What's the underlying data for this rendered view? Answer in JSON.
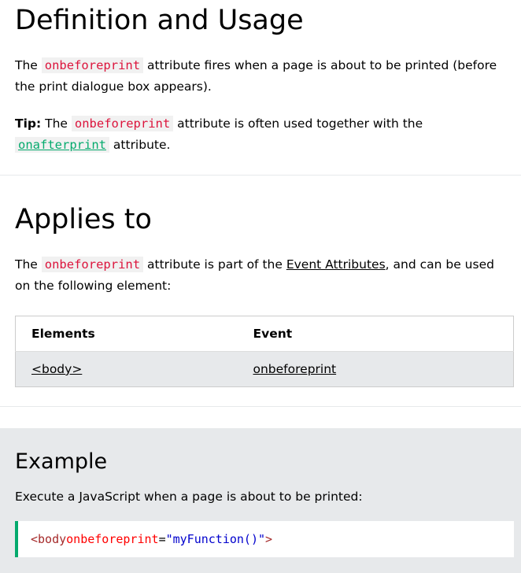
{
  "definition": {
    "title": "Definition and Usage",
    "p1_before": "The ",
    "p1_code": "onbeforeprint",
    "p1_after": " attribute fires when a page is about to be printed (before the print dialogue box appears).",
    "tip_label": "Tip:",
    "tip_before": " The ",
    "tip_code": "onbeforeprint",
    "tip_middle": " attribute is often used together with the ",
    "tip_link": "onafterprint",
    "tip_after": " attribute."
  },
  "applies": {
    "title": "Applies to",
    "p_before": "The ",
    "p_code": "onbeforeprint",
    "p_middle": " attribute is part of the ",
    "p_link": "Event Attributes",
    "p_after": ", and can be used on the following element:",
    "table": {
      "headers": [
        "Elements",
        "Event"
      ],
      "rows": [
        [
          "<body>",
          "onbeforeprint"
        ]
      ]
    }
  },
  "example": {
    "title": "Example",
    "description": "Execute a JavaScript when a page is about to be printed:",
    "code": {
      "tag_open": "<body",
      "attr": " onbeforeprint",
      "eq": "=",
      "value": "\"myFunction()\"",
      "tag_close": ">"
    },
    "accent_color": "#04aa6d"
  }
}
